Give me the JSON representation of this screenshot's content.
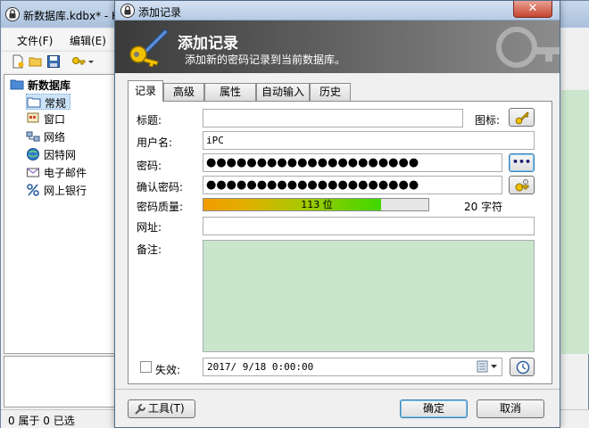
{
  "main_window": {
    "title": "新数据库.kdbx* - K",
    "close_glyph": "✕",
    "menu": {
      "file": "文件(F)",
      "edit": "编辑(E)"
    },
    "tree": {
      "root": "新数据库",
      "groups": [
        "常规",
        "窗口",
        "网络",
        "因特网",
        "电子邮件",
        "网上银行"
      ]
    },
    "status": "0 属于 0 已选"
  },
  "dialog": {
    "title": "添加记录",
    "close_glyph": "✕",
    "banner": {
      "title": "添加记录",
      "subtitle": "添加新的密码记录到当前数据库。"
    },
    "tabs": [
      {
        "label": "记录",
        "active": true
      },
      {
        "label": "高级",
        "active": false
      },
      {
        "label": "属性",
        "active": false
      },
      {
        "label": "自动输入",
        "active": false
      },
      {
        "label": "历史",
        "active": false
      }
    ],
    "fields": {
      "title_label": "标题:",
      "title_value": "",
      "icon_label": "图标:",
      "username_label": "用户名:",
      "username_value": "iPC",
      "password_label": "密码:",
      "password_value": "●●●●●●●●●●●●●●●●●●●●●",
      "show_password_glyph": "•••",
      "repeat_label": "确认密码:",
      "repeat_value": "●●●●●●●●●●●●●●●●●●●●●",
      "quality_label": "密码质量:",
      "quality_text": "113 位",
      "quality_fraction": 0.79,
      "chars_text": "20 字符",
      "url_label": "网址:",
      "url_value": "",
      "notes_label": "备注:",
      "expires_label": "失效:",
      "expires_checked": false,
      "expires_value": "2017/ 9/18  0:00:00"
    },
    "buttons": {
      "tools": "工具(T)",
      "ok": "确定",
      "cancel": "取消"
    },
    "colors": {
      "notes_bg": "#c9e6cc",
      "quality_start": "#f29c00",
      "quality_end": "#3ed800",
      "banner_dark": "#3b3b3b"
    }
  }
}
